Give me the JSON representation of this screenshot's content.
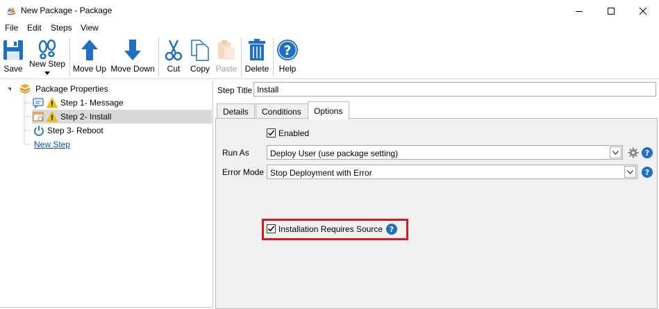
{
  "window": {
    "title": "New Package - Package"
  },
  "menu": [
    "File",
    "Edit",
    "Steps",
    "View"
  ],
  "toolbar": {
    "save": "Save",
    "new_step": "New Step",
    "move_up": "Move Up",
    "move_down": "Move Down",
    "cut": "Cut",
    "copy": "Copy",
    "paste": "Paste",
    "delete": "Delete",
    "help": "Help"
  },
  "tree": {
    "root": "Package Properties",
    "steps": [
      {
        "label": "Step 1- Message",
        "icon": "message-icon",
        "warning": true
      },
      {
        "label": "Step 2- Install",
        "icon": "install-icon",
        "warning": true
      },
      {
        "label": "Step 3- Reboot",
        "icon": "power-icon",
        "warning": false
      }
    ],
    "new_step_link": "New Step"
  },
  "step": {
    "title_label": "Step Title",
    "title_value": "Install"
  },
  "tabs": [
    "Details",
    "Conditions",
    "Options"
  ],
  "active_tab": "Options",
  "options": {
    "enabled_label": "Enabled",
    "enabled_checked": true,
    "run_as_label": "Run As",
    "run_as_value": "Deploy User (use package setting)",
    "error_mode_label": "Error Mode",
    "error_mode_value": "Stop Deployment with Error",
    "requires_source_label": "Installation Requires Source",
    "requires_source_checked": true,
    "help_glyph": "?"
  },
  "colors": {
    "accent_blue": "#1f6fc5",
    "highlight_red": "#e0141e",
    "warning_yellow": "#f5c400",
    "selection_gray": "#d9d9d9"
  }
}
